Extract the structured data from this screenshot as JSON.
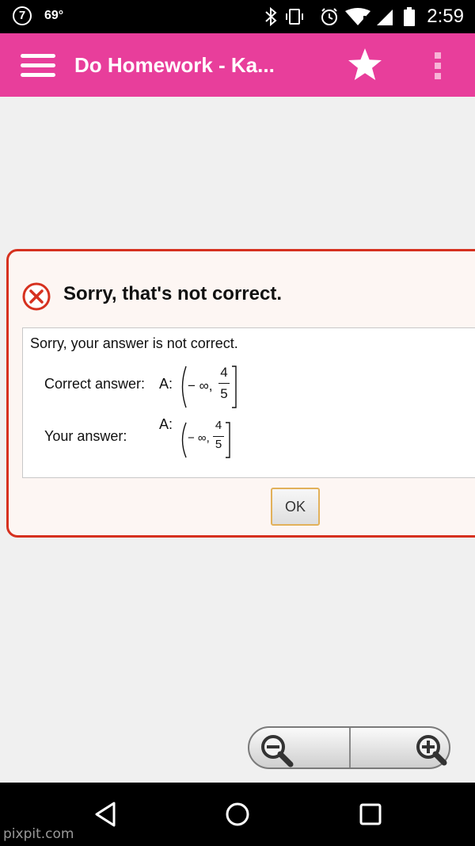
{
  "status_bar": {
    "notification_badge": "7",
    "temperature": "69°",
    "time": "2:59",
    "icons": [
      "bluetooth-icon",
      "vibrate-icon",
      "alarm-icon",
      "wifi-icon",
      "signal-icon",
      "battery-icon"
    ]
  },
  "app_bar": {
    "title": "Do Homework - Ka...",
    "background": "#e83e9b",
    "icons": [
      "menu-icon",
      "star-icon",
      "more-vert-icon"
    ]
  },
  "dialog": {
    "heading": "Sorry, that's not correct.",
    "message": "Sorry, your answer is not correct.",
    "correct_label": "Correct answer:",
    "your_label": "Your answer:",
    "correct_answer": {
      "prefix": "A:",
      "lower": "− ∞,",
      "numerator": "4",
      "denominator": "5"
    },
    "your_answer": {
      "prefix": "A:",
      "lower": "− ∞,",
      "numerator": "4",
      "denominator": "5"
    },
    "ok_label": "OK",
    "border_color": "#d6311f"
  },
  "zoom_controls": {
    "icons": [
      "zoom-out-icon",
      "zoom-in-icon"
    ]
  },
  "nav_bar": {
    "icons": [
      "back-icon",
      "home-icon",
      "recents-icon"
    ]
  },
  "watermark": "pixpit.com"
}
